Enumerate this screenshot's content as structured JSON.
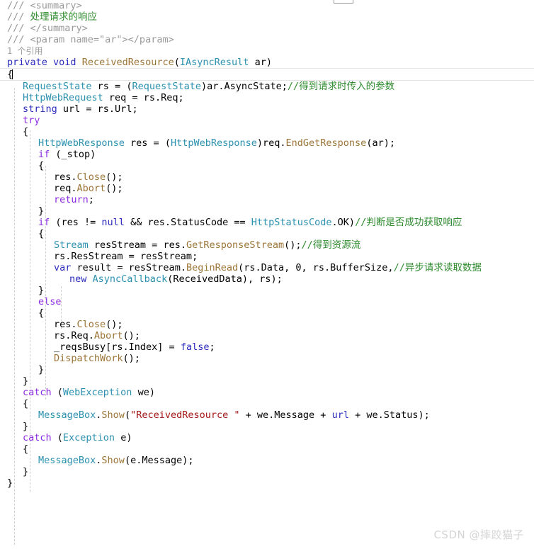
{
  "editor": {
    "language": "csharp",
    "watermark": "CSDN @摔跤猫子",
    "codelens": "1 个引用",
    "colors": {
      "background": "#ffffff",
      "comment": "#2e8b2e",
      "xmldoc": "#9a9a9a",
      "keyword": "#2b2bbf",
      "control": "#8a2be2",
      "type": "#2b91af",
      "method": "#9b7436",
      "string": "#a31515",
      "plain": "#000000",
      "indent_guide": "#cfcfcf",
      "current_line_border": "#e6e6e6",
      "watermark": "#d4d4d4"
    }
  },
  "code": {
    "lines": [
      {
        "id": "l1",
        "indent": 0,
        "tokens": [
          {
            "t": "xmldoc",
            "v": "/// <summary>"
          }
        ]
      },
      {
        "id": "l2",
        "indent": 0,
        "tokens": [
          {
            "t": "xmldoc",
            "v": "/// "
          },
          {
            "t": "cmt",
            "v": "处理请求的响应"
          }
        ]
      },
      {
        "id": "l3",
        "indent": 0,
        "tokens": [
          {
            "t": "xmldoc",
            "v": "/// </summary>"
          }
        ]
      },
      {
        "id": "l4",
        "indent": 0,
        "tokens": [
          {
            "t": "xmldoc",
            "v": "/// <param name=\"ar\"></param>"
          }
        ]
      },
      {
        "id": "l5",
        "indent": 0,
        "tokens": [
          {
            "t": "lens",
            "v": "1 个引用"
          }
        ]
      },
      {
        "id": "l6",
        "indent": 0,
        "tokens": [
          {
            "t": "kw",
            "v": "private"
          },
          {
            "t": "plain",
            "v": " "
          },
          {
            "t": "kw",
            "v": "void"
          },
          {
            "t": "plain",
            "v": " "
          },
          {
            "t": "meth",
            "v": "ReceivedResource"
          },
          {
            "t": "plain",
            "v": "("
          },
          {
            "t": "type",
            "v": "IAsyncResult"
          },
          {
            "t": "plain",
            "v": " ar)"
          }
        ]
      },
      {
        "id": "l7",
        "indent": 0,
        "current": true,
        "tokens": [
          {
            "t": "plain",
            "v": "{"
          },
          {
            "t": "caret",
            "v": ""
          }
        ]
      },
      {
        "id": "l8",
        "indent": 1,
        "tokens": [
          {
            "t": "type",
            "v": "RequestState"
          },
          {
            "t": "plain",
            "v": " rs = ("
          },
          {
            "t": "type",
            "v": "RequestState"
          },
          {
            "t": "plain",
            "v": ")ar.AsyncState;"
          },
          {
            "t": "cmt",
            "v": "//得到请求时传入的参数"
          }
        ]
      },
      {
        "id": "l9",
        "indent": 1,
        "tokens": [
          {
            "t": "type",
            "v": "HttpWebRequest"
          },
          {
            "t": "plain",
            "v": " req = rs.Req;"
          }
        ]
      },
      {
        "id": "l10",
        "indent": 1,
        "tokens": [
          {
            "t": "kw",
            "v": "string"
          },
          {
            "t": "plain",
            "v": " url = rs.Url;"
          }
        ]
      },
      {
        "id": "l11",
        "indent": 1,
        "tokens": [
          {
            "t": "ctl",
            "v": "try"
          }
        ]
      },
      {
        "id": "l12",
        "indent": 1,
        "tokens": [
          {
            "t": "plain",
            "v": "{"
          }
        ]
      },
      {
        "id": "l13",
        "indent": 2,
        "tokens": [
          {
            "t": "type",
            "v": "HttpWebResponse"
          },
          {
            "t": "plain",
            "v": " res = ("
          },
          {
            "t": "type",
            "v": "HttpWebResponse"
          },
          {
            "t": "plain",
            "v": ")req."
          },
          {
            "t": "meth",
            "v": "EndGetResponse"
          },
          {
            "t": "plain",
            "v": "(ar);"
          }
        ]
      },
      {
        "id": "l14",
        "indent": 2,
        "tokens": [
          {
            "t": "ctl",
            "v": "if"
          },
          {
            "t": "plain",
            "v": " (_stop)"
          }
        ]
      },
      {
        "id": "l15",
        "indent": 2,
        "tokens": [
          {
            "t": "plain",
            "v": "{"
          }
        ]
      },
      {
        "id": "l16",
        "indent": 3,
        "tokens": [
          {
            "t": "plain",
            "v": "res."
          },
          {
            "t": "meth",
            "v": "Close"
          },
          {
            "t": "plain",
            "v": "();"
          }
        ]
      },
      {
        "id": "l17",
        "indent": 3,
        "tokens": [
          {
            "t": "plain",
            "v": "req."
          },
          {
            "t": "meth",
            "v": "Abort"
          },
          {
            "t": "plain",
            "v": "();"
          }
        ]
      },
      {
        "id": "l18",
        "indent": 3,
        "tokens": [
          {
            "t": "ctl",
            "v": "return"
          },
          {
            "t": "plain",
            "v": ";"
          }
        ]
      },
      {
        "id": "l19",
        "indent": 2,
        "tokens": [
          {
            "t": "plain",
            "v": "}"
          }
        ]
      },
      {
        "id": "l20",
        "indent": 2,
        "tokens": [
          {
            "t": "ctl",
            "v": "if"
          },
          {
            "t": "plain",
            "v": " (res != "
          },
          {
            "t": "kw",
            "v": "null"
          },
          {
            "t": "plain",
            "v": " && res.StatusCode == "
          },
          {
            "t": "type",
            "v": "HttpStatusCode"
          },
          {
            "t": "plain",
            "v": ".OK)"
          },
          {
            "t": "cmt",
            "v": "//判断是否成功获取响应"
          }
        ]
      },
      {
        "id": "l21",
        "indent": 2,
        "tokens": [
          {
            "t": "plain",
            "v": "{"
          }
        ]
      },
      {
        "id": "l22",
        "indent": 3,
        "tokens": [
          {
            "t": "type",
            "v": "Stream"
          },
          {
            "t": "plain",
            "v": " resStream = res."
          },
          {
            "t": "meth",
            "v": "GetResponseStream"
          },
          {
            "t": "plain",
            "v": "();"
          },
          {
            "t": "cmt",
            "v": "//得到资源流"
          }
        ]
      },
      {
        "id": "l23",
        "indent": 3,
        "tokens": [
          {
            "t": "plain",
            "v": "rs.ResStream = resStream;"
          }
        ]
      },
      {
        "id": "l24",
        "indent": 3,
        "tokens": [
          {
            "t": "kw",
            "v": "var"
          },
          {
            "t": "plain",
            "v": " result = resStream."
          },
          {
            "t": "meth",
            "v": "BeginRead"
          },
          {
            "t": "plain",
            "v": "(rs.Data, 0, rs.BufferSize,"
          },
          {
            "t": "cmt",
            "v": "//异步请求读取数据"
          }
        ]
      },
      {
        "id": "l25",
        "indent": 4,
        "tokens": [
          {
            "t": "kw",
            "v": "new"
          },
          {
            "t": "plain",
            "v": " "
          },
          {
            "t": "type",
            "v": "AsyncCallback"
          },
          {
            "t": "plain",
            "v": "(ReceivedData), rs);"
          }
        ]
      },
      {
        "id": "l26",
        "indent": 2,
        "tokens": [
          {
            "t": "plain",
            "v": "}"
          }
        ]
      },
      {
        "id": "l27",
        "indent": 2,
        "tokens": [
          {
            "t": "ctl",
            "v": "else"
          }
        ]
      },
      {
        "id": "l28",
        "indent": 2,
        "tokens": [
          {
            "t": "plain",
            "v": "{"
          }
        ]
      },
      {
        "id": "l29",
        "indent": 3,
        "tokens": [
          {
            "t": "plain",
            "v": "res."
          },
          {
            "t": "meth",
            "v": "Close"
          },
          {
            "t": "plain",
            "v": "();"
          }
        ]
      },
      {
        "id": "l30",
        "indent": 3,
        "tokens": [
          {
            "t": "plain",
            "v": "rs.Req."
          },
          {
            "t": "meth",
            "v": "Abort"
          },
          {
            "t": "plain",
            "v": "();"
          }
        ]
      },
      {
        "id": "l31",
        "indent": 3,
        "tokens": [
          {
            "t": "plain",
            "v": "_reqsBusy[rs.Index] = "
          },
          {
            "t": "kw",
            "v": "false"
          },
          {
            "t": "plain",
            "v": ";"
          }
        ]
      },
      {
        "id": "l32",
        "indent": 3,
        "tokens": [
          {
            "t": "meth",
            "v": "DispatchWork"
          },
          {
            "t": "plain",
            "v": "();"
          }
        ]
      },
      {
        "id": "l33",
        "indent": 2,
        "tokens": [
          {
            "t": "plain",
            "v": "}"
          }
        ]
      },
      {
        "id": "l34",
        "indent": 1,
        "tokens": [
          {
            "t": "plain",
            "v": "}"
          }
        ]
      },
      {
        "id": "l35",
        "indent": 1,
        "tokens": [
          {
            "t": "ctl",
            "v": "catch"
          },
          {
            "t": "plain",
            "v": " ("
          },
          {
            "t": "type",
            "v": "WebException"
          },
          {
            "t": "plain",
            "v": " we)"
          }
        ]
      },
      {
        "id": "l36",
        "indent": 1,
        "tokens": [
          {
            "t": "plain",
            "v": "{"
          }
        ]
      },
      {
        "id": "l37",
        "indent": 2,
        "tokens": [
          {
            "t": "type",
            "v": "MessageBox"
          },
          {
            "t": "plain",
            "v": "."
          },
          {
            "t": "meth",
            "v": "Show"
          },
          {
            "t": "plain",
            "v": "("
          },
          {
            "t": "str",
            "v": "\"ReceivedResource \""
          },
          {
            "t": "plain",
            "v": " + we.Message + "
          },
          {
            "t": "kw",
            "v": "url"
          },
          {
            "t": "plain",
            "v": " + we.Status);"
          }
        ]
      },
      {
        "id": "l38",
        "indent": 1,
        "tokens": [
          {
            "t": "plain",
            "v": "}"
          }
        ]
      },
      {
        "id": "l39",
        "indent": 1,
        "tokens": [
          {
            "t": "ctl",
            "v": "catch"
          },
          {
            "t": "plain",
            "v": " ("
          },
          {
            "t": "type",
            "v": "Exception"
          },
          {
            "t": "plain",
            "v": " e)"
          }
        ]
      },
      {
        "id": "l40",
        "indent": 1,
        "tokens": [
          {
            "t": "plain",
            "v": "{"
          }
        ]
      },
      {
        "id": "l41",
        "indent": 2,
        "tokens": [
          {
            "t": "type",
            "v": "MessageBox"
          },
          {
            "t": "plain",
            "v": "."
          },
          {
            "t": "meth",
            "v": "Show"
          },
          {
            "t": "plain",
            "v": "(e.Message);"
          }
        ]
      },
      {
        "id": "l42",
        "indent": 1,
        "tokens": [
          {
            "t": "plain",
            "v": "}"
          }
        ]
      },
      {
        "id": "l43",
        "indent": 0,
        "tokens": [
          {
            "t": "plain",
            "v": "}"
          }
        ]
      }
    ],
    "indent_guide_columns": [
      1,
      2,
      3,
      4
    ]
  }
}
